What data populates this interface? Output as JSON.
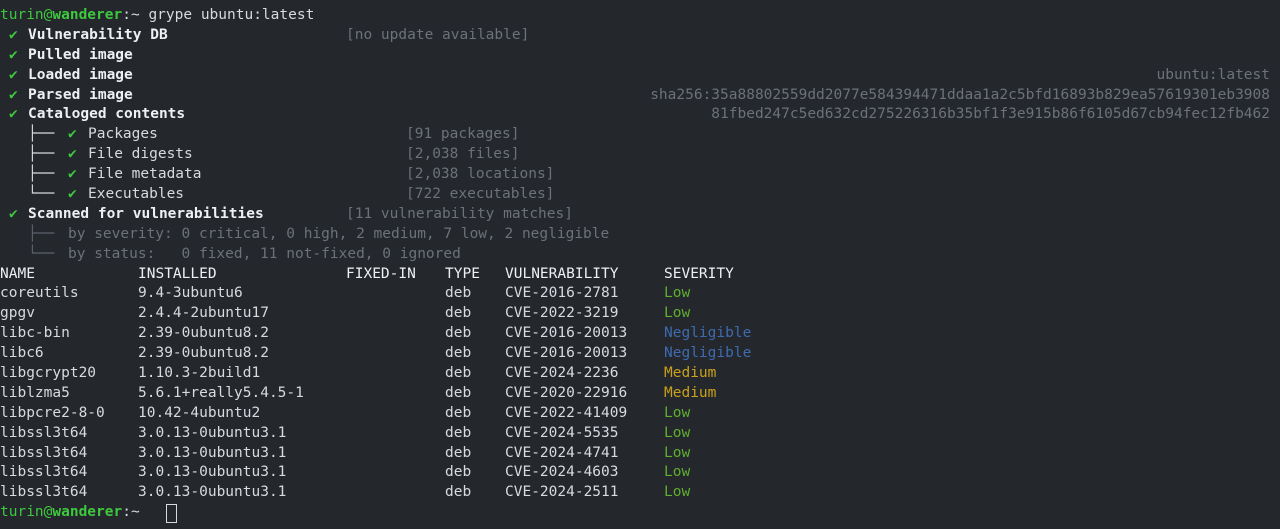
{
  "prompt": {
    "user": "turin",
    "at": "@",
    "host": "wanderer",
    "path": ":~",
    "symbol": " ",
    "command": "grype ubuntu:latest"
  },
  "steps": [
    {
      "check": "✔",
      "label": "Vulnerability DB",
      "status": "[no update available]",
      "right": ""
    },
    {
      "check": "✔",
      "label": "Pulled image",
      "status": "",
      "right": ""
    },
    {
      "check": "✔",
      "label": "Loaded image",
      "status": "",
      "right": "ubuntu:latest"
    },
    {
      "check": "✔",
      "label": "Parsed image",
      "status": "",
      "right": "sha256:35a88802559dd2077e584394471ddaa1a2c5bfd16893b829ea57619301eb3908"
    },
    {
      "check": "✔",
      "label": "Cataloged contents",
      "status": "",
      "right": "81fbed247c5ed632cd275226316b35bf1f3e915b86f6105d67cb94fec12fb462"
    }
  ],
  "catalog": [
    {
      "branch": "├──",
      "label": "Packages",
      "status": "[91 packages]"
    },
    {
      "branch": "├──",
      "label": "File digests",
      "status": "[2,038 files]"
    },
    {
      "branch": "├──",
      "label": "File metadata",
      "status": "[2,038 locations]"
    },
    {
      "branch": "└──",
      "label": "Executables",
      "status": "[722 executables]"
    }
  ],
  "scan": {
    "check": "✔",
    "label": "Scanned for vulnerabilities",
    "status": "[11 vulnerability matches]",
    "by_severity_branch": "├──",
    "by_severity": "by severity: 0 critical, 0 high, 2 medium, 7 low, 2 negligible",
    "by_status_branch": "└──",
    "by_status": "by status:   0 fixed, 11 not-fixed, 0 ignored"
  },
  "table": {
    "headers": {
      "name": "NAME",
      "installed": "INSTALLED",
      "fixed_in": "FIXED-IN",
      "type": "TYPE",
      "vulnerability": "VULNERABILITY",
      "severity": "SEVERITY"
    },
    "rows": [
      {
        "name": "coreutils",
        "installed": "9.4-3ubuntu6",
        "fixed_in": "",
        "type": "deb",
        "vulnerability": "CVE-2016-2781",
        "severity": "Low"
      },
      {
        "name": "gpgv",
        "installed": "2.4.4-2ubuntu17",
        "fixed_in": "",
        "type": "deb",
        "vulnerability": "CVE-2022-3219",
        "severity": "Low"
      },
      {
        "name": "libc-bin",
        "installed": "2.39-0ubuntu8.2",
        "fixed_in": "",
        "type": "deb",
        "vulnerability": "CVE-2016-20013",
        "severity": "Negligible"
      },
      {
        "name": "libc6",
        "installed": "2.39-0ubuntu8.2",
        "fixed_in": "",
        "type": "deb",
        "vulnerability": "CVE-2016-20013",
        "severity": "Negligible"
      },
      {
        "name": "libgcrypt20",
        "installed": "1.10.3-2build1",
        "fixed_in": "",
        "type": "deb",
        "vulnerability": "CVE-2024-2236",
        "severity": "Medium"
      },
      {
        "name": "liblzma5",
        "installed": "5.6.1+really5.4.5-1",
        "fixed_in": "",
        "type": "deb",
        "vulnerability": "CVE-2020-22916",
        "severity": "Medium"
      },
      {
        "name": "libpcre2-8-0",
        "installed": "10.42-4ubuntu2",
        "fixed_in": "",
        "type": "deb",
        "vulnerability": "CVE-2022-41409",
        "severity": "Low"
      },
      {
        "name": "libssl3t64",
        "installed": "3.0.13-0ubuntu3.1",
        "fixed_in": "",
        "type": "deb",
        "vulnerability": "CVE-2024-5535",
        "severity": "Low"
      },
      {
        "name": "libssl3t64",
        "installed": "3.0.13-0ubuntu3.1",
        "fixed_in": "",
        "type": "deb",
        "vulnerability": "CVE-2024-4741",
        "severity": "Low"
      },
      {
        "name": "libssl3t64",
        "installed": "3.0.13-0ubuntu3.1",
        "fixed_in": "",
        "type": "deb",
        "vulnerability": "CVE-2024-4603",
        "severity": "Low"
      },
      {
        "name": "libssl3t64",
        "installed": "3.0.13-0ubuntu3.1",
        "fixed_in": "",
        "type": "deb",
        "vulnerability": "CVE-2024-2511",
        "severity": "Low"
      }
    ]
  },
  "colors": {
    "background": "#24272c",
    "prompt": "#3ec83e",
    "low": "#5fae2e",
    "negligible": "#3e6bb0",
    "medium": "#c9a11a"
  }
}
